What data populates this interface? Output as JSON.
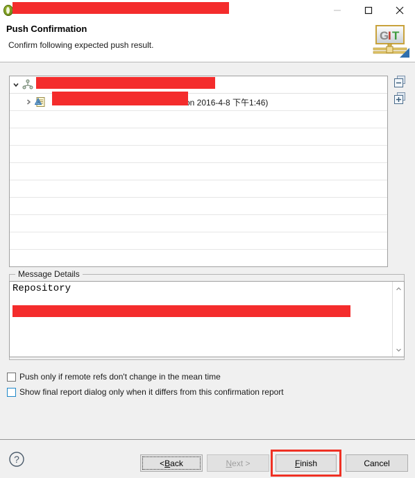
{
  "window": {
    "title_redacted": true,
    "icon": "eclipse-icon",
    "controls": {
      "minimize": "minimize-icon",
      "maximize": "maximize-icon",
      "close": "close-icon"
    }
  },
  "header": {
    "title": "Push Confirmation",
    "subtitle": "Confirm following expected push result.",
    "logo": {
      "letters": [
        "G",
        "I",
        "T"
      ],
      "colors": [
        "#8a8a8a",
        "#c0392b",
        "#3f9b3f"
      ]
    }
  },
  "tree": {
    "rows": [
      {
        "twisty": "chevron-down-icon",
        "icon": "repository-icon",
        "label": "",
        "redacted": true,
        "level": 0
      },
      {
        "twisty": "chevron-right-icon",
        "icon": "ref-update-icon",
        "label": "on 2016-4-8 下午1:46)",
        "redacted": true,
        "level": 1
      }
    ],
    "empty_row_count": 9,
    "side_buttons": [
      {
        "name": "collapse-all-button",
        "glyph": "minus"
      },
      {
        "name": "expand-all-button",
        "glyph": "plus"
      }
    ]
  },
  "message_details": {
    "group_label": "Message Details",
    "text": "Repository",
    "redacted_line": true,
    "scrollbar": {
      "up": "chevron-up-icon",
      "down": "chevron-down-icon"
    }
  },
  "checkboxes": [
    {
      "label": "Push only if remote refs don't change in the mean time",
      "checked": false,
      "focused": false
    },
    {
      "label": "Show final report dialog only when it differs from this confirmation report",
      "checked": false,
      "focused": true
    }
  ],
  "footer": {
    "help": "?",
    "buttons": [
      {
        "name": "back-button",
        "label_pre": "< ",
        "label_key": "B",
        "label_post": "ack",
        "state": "focused"
      },
      {
        "name": "next-button",
        "label_pre": "",
        "label_key": "N",
        "label_post": "ext >",
        "state": "disabled"
      },
      {
        "name": "finish-button",
        "label_pre": "",
        "label_key": "F",
        "label_post": "inish",
        "state": "highlighted"
      },
      {
        "name": "cancel-button",
        "label_pre": "",
        "label_key": "",
        "label_post": "Cancel",
        "state": "normal"
      }
    ],
    "highlight_color": "#ef3124"
  }
}
